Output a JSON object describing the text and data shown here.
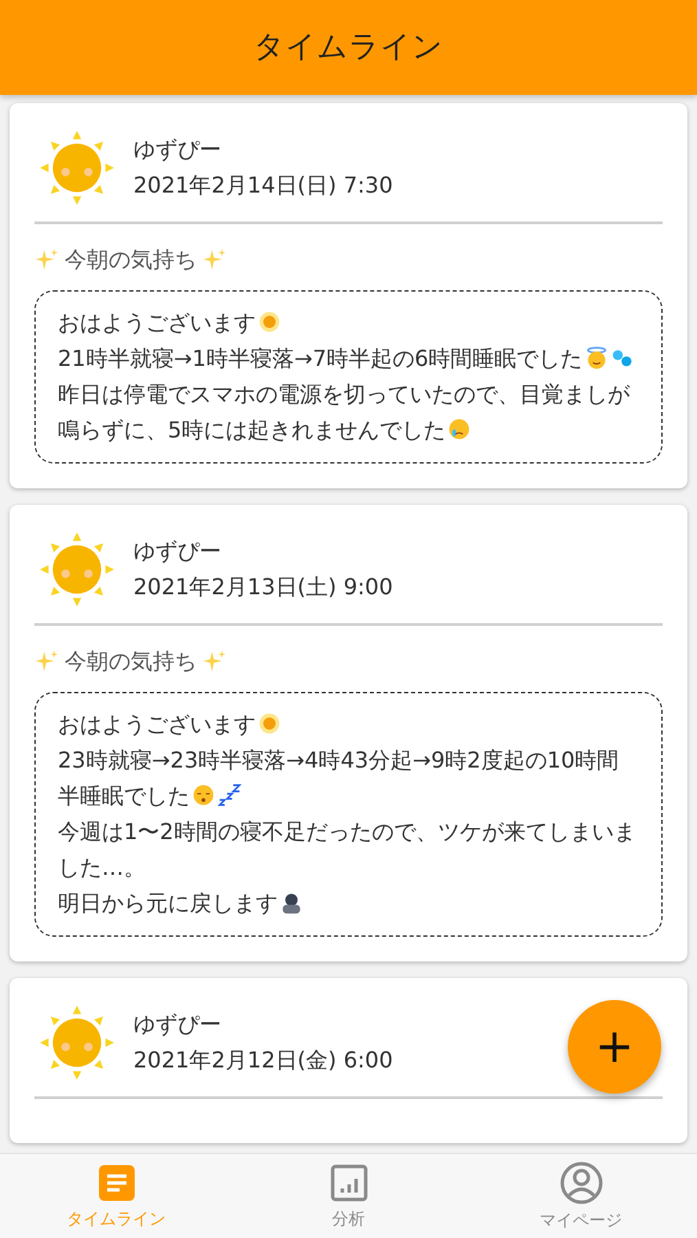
{
  "header": {
    "title": "タイムライン"
  },
  "posts": [
    {
      "user": "ゆずぴー",
      "date": "2021年2月14日(日) 7:30",
      "heading": "今朝の気持ち",
      "paragraphs": [
        {
          "text": "おはようございます",
          "emojis": [
            {
              "kind": "sun"
            }
          ]
        },
        {
          "text": "21時半就寝→1時半寝落→7時半起の6時間睡眠でした",
          "emojis": [
            {
              "kind": "halo-face"
            },
            {
              "kind": "sweat-drops"
            }
          ]
        },
        {
          "text": "昨日は停電でスマホの電源を切っていたので、目覚ましが鳴らずに、5時には起きれませんでした",
          "emojis": [
            {
              "kind": "crying-face"
            }
          ]
        }
      ]
    },
    {
      "user": "ゆずぴー",
      "date": "2021年2月13日(土) 9:00",
      "heading": "今朝の気持ち",
      "paragraphs": [
        {
          "text": "おはようございます",
          "emojis": [
            {
              "kind": "sun"
            }
          ]
        },
        {
          "text": "23時就寝→23時半寝落→4時43分起→9時2度起の10時間半睡眠でした",
          "emojis": [
            {
              "kind": "sleeping-face"
            },
            {
              "kind": "zzz"
            }
          ]
        },
        {
          "text": "今週は1〜2時間の寝不足だったので、ツケが来てしまいました…。"
        },
        {
          "text": "明日から元に戻します",
          "emojis": [
            {
              "kind": "bowing-person"
            }
          ]
        }
      ]
    },
    {
      "user": "ゆずぴー",
      "date": "2021年2月12日(金) 6:00"
    }
  ],
  "fab": {
    "label": "+"
  },
  "nav": [
    {
      "kind": "timeline",
      "label": "タイムライン",
      "selected": true
    },
    {
      "kind": "analytics",
      "label": "分析",
      "selected": false
    },
    {
      "kind": "mypage",
      "label": "マイページ",
      "selected": false
    }
  ]
}
